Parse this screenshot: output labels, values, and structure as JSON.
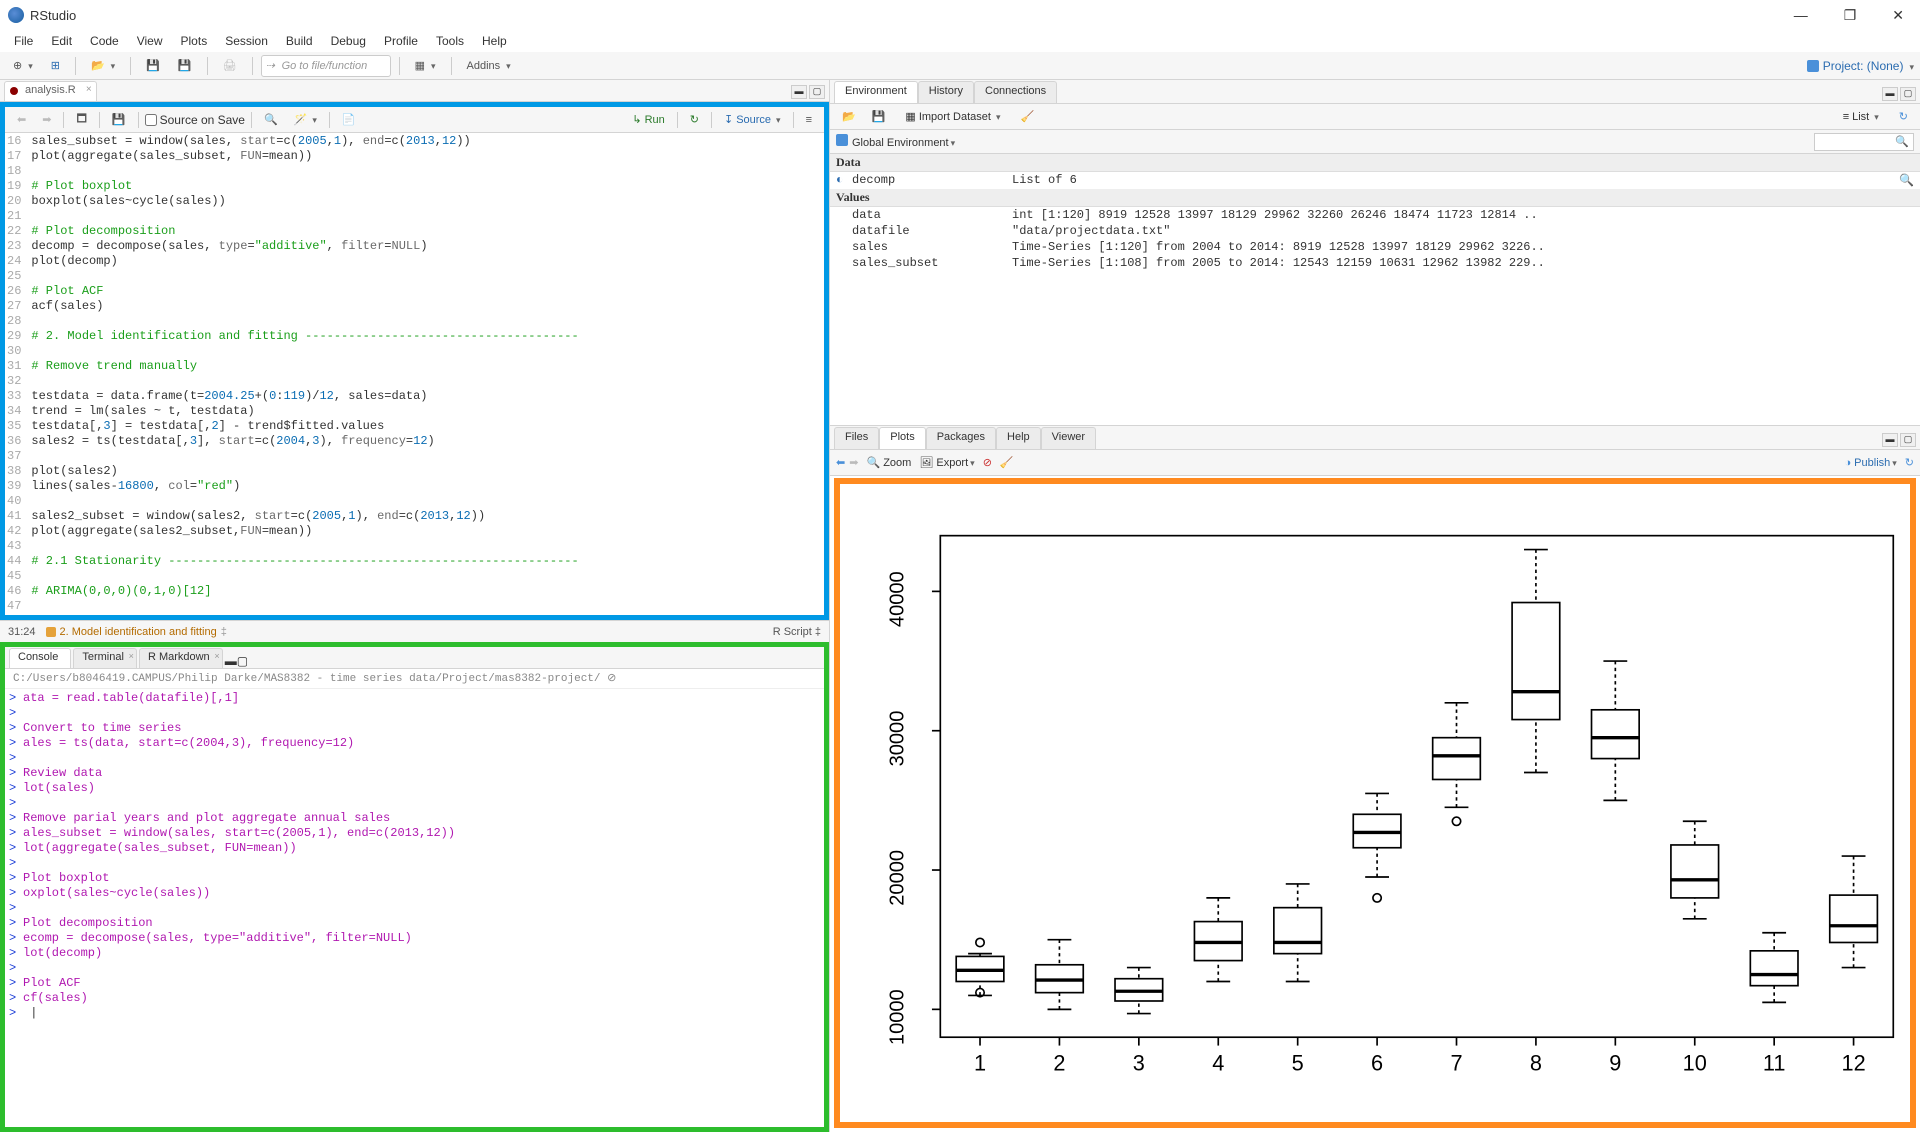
{
  "app": {
    "title": "RStudio"
  },
  "menubar": [
    "File",
    "Edit",
    "Code",
    "View",
    "Plots",
    "Session",
    "Build",
    "Debug",
    "Profile",
    "Tools",
    "Help"
  ],
  "main_toolbar": {
    "gotofile_placeholder": "Go to file/function",
    "addins": "Addins",
    "project": "Project: (None)"
  },
  "editor": {
    "tab": "analysis.R",
    "source_on_save": "Source on Save",
    "run": "Run",
    "source": "Source",
    "status_pos": "31:24",
    "status_crumb": "2. Model identification and fitting",
    "status_right": "R Script",
    "code": [
      {
        "n": 16,
        "t": "sales_subset = window(sales, start=c(2005,1), end=c(2013,12))"
      },
      {
        "n": 17,
        "t": "plot(aggregate(sales_subset, FUN=mean))"
      },
      {
        "n": 18,
        "t": ""
      },
      {
        "n": 19,
        "t": "# Plot boxplot",
        "c": true
      },
      {
        "n": 20,
        "t": "boxplot(sales~cycle(sales))"
      },
      {
        "n": 21,
        "t": ""
      },
      {
        "n": 22,
        "t": "# Plot decomposition",
        "c": true
      },
      {
        "n": 23,
        "t": "decomp = decompose(sales, type=\"additive\", filter=NULL)"
      },
      {
        "n": 24,
        "t": "plot(decomp)"
      },
      {
        "n": 25,
        "t": ""
      },
      {
        "n": 26,
        "t": "# Plot ACF",
        "c": true
      },
      {
        "n": 27,
        "t": "acf(sales)"
      },
      {
        "n": 28,
        "t": ""
      },
      {
        "n": 29,
        "t": "# 2. Model identification and fitting --------------------------------------",
        "c": true
      },
      {
        "n": 30,
        "t": ""
      },
      {
        "n": 31,
        "t": "# Remove trend manually",
        "c": true
      },
      {
        "n": 32,
        "t": ""
      },
      {
        "n": 33,
        "t": "testdata = data.frame(t=2004.25+(0:119)/12, sales=data)"
      },
      {
        "n": 34,
        "t": "trend = lm(sales ~ t, testdata)"
      },
      {
        "n": 35,
        "t": "testdata[,3] = testdata[,2] - trend$fitted.values"
      },
      {
        "n": 36,
        "t": "sales2 = ts(testdata[,3], start=c(2004,3), frequency=12)"
      },
      {
        "n": 37,
        "t": ""
      },
      {
        "n": 38,
        "t": "plot(sales2)"
      },
      {
        "n": 39,
        "t": "lines(sales-16800, col=\"red\")"
      },
      {
        "n": 40,
        "t": ""
      },
      {
        "n": 41,
        "t": "sales2_subset = window(sales2, start=c(2005,1), end=c(2013,12))"
      },
      {
        "n": 42,
        "t": "plot(aggregate(sales2_subset,FUN=mean))"
      },
      {
        "n": 43,
        "t": ""
      },
      {
        "n": 44,
        "t": "# 2.1 Stationarity ---------------------------------------------------------",
        "c": true
      },
      {
        "n": 45,
        "t": ""
      },
      {
        "n": 46,
        "t": "# ARIMA(0,0,0)(0,1,0)[12]",
        "c": true
      },
      {
        "n": 47,
        "t": ""
      }
    ]
  },
  "console": {
    "tabs": [
      "Console",
      "Terminal",
      "R Markdown"
    ],
    "path": "C:/Users/b8046419.CAMPUS/Philip Darke/MAS8382 - time series data/Project/mas8382-project/",
    "lines": [
      "ata = read.table(datafile)[,1]",
      "",
      " Convert to time series",
      "ales = ts(data, start=c(2004,3), frequency=12)",
      "",
      " Review data",
      "lot(sales)",
      "",
      " Remove parial years and plot aggregate annual sales",
      "ales_subset = window(sales, start=c(2005,1), end=c(2013,12))",
      "lot(aggregate(sales_subset, FUN=mean))",
      "",
      " Plot boxplot",
      "oxplot(sales~cycle(sales))",
      "",
      " Plot decomposition",
      "ecomp = decompose(sales, type=\"additive\", filter=NULL)",
      "lot(decomp)",
      "",
      " Plot ACF",
      "cf(sales)"
    ]
  },
  "env": {
    "tabs": [
      "Environment",
      "History",
      "Connections"
    ],
    "import": "Import Dataset",
    "list": "List",
    "scope": "Global Environment",
    "sections": {
      "Data": [
        {
          "name": "decomp",
          "value": "List of 6",
          "exp": true,
          "lens": true
        }
      ],
      "Values": [
        {
          "name": "data",
          "value": "int [1:120] 8919 12528 13997 18129 29962 32260 26246 18474 11723 12814 .."
        },
        {
          "name": "datafile",
          "value": "\"data/projectdata.txt\""
        },
        {
          "name": "sales",
          "value": "Time-Series [1:120] from 2004 to 2014: 8919 12528 13997 18129 29962 3226.."
        },
        {
          "name": "sales_subset",
          "value": "Time-Series [1:108] from 2005 to 2014: 12543 12159 10631 12962 13982 229.."
        }
      ]
    }
  },
  "plots": {
    "tabs": [
      "Files",
      "Plots",
      "Packages",
      "Help",
      "Viewer"
    ],
    "zoom": "Zoom",
    "export": "Export",
    "publish": "Publish"
  },
  "chart_data": {
    "type": "boxplot",
    "xlabel": "",
    "ylabel": "",
    "yticks": [
      10000,
      20000,
      30000,
      40000
    ],
    "xticks": [
      "1",
      "2",
      "3",
      "4",
      "5",
      "6",
      "7",
      "8",
      "9",
      "10",
      "11",
      "12"
    ],
    "ylim": [
      8000,
      44000
    ],
    "series": [
      {
        "x": 1,
        "min": 11000,
        "q1": 12000,
        "med": 12800,
        "q3": 13800,
        "max": 14000,
        "outliers": [
          14800,
          11200
        ]
      },
      {
        "x": 2,
        "min": 10000,
        "q1": 11200,
        "med": 12100,
        "q3": 13200,
        "max": 15000,
        "outliers": []
      },
      {
        "x": 3,
        "min": 9700,
        "q1": 10600,
        "med": 11300,
        "q3": 12200,
        "max": 13000,
        "outliers": []
      },
      {
        "x": 4,
        "min": 12000,
        "q1": 13500,
        "med": 14800,
        "q3": 16300,
        "max": 18000,
        "outliers": []
      },
      {
        "x": 5,
        "min": 12000,
        "q1": 14000,
        "med": 14800,
        "q3": 17300,
        "max": 19000,
        "outliers": []
      },
      {
        "x": 6,
        "min": 19500,
        "q1": 21600,
        "med": 22700,
        "q3": 24000,
        "max": 25500,
        "outliers": [
          18000
        ]
      },
      {
        "x": 7,
        "min": 24500,
        "q1": 26500,
        "med": 28200,
        "q3": 29500,
        "max": 32000,
        "outliers": [
          23500
        ]
      },
      {
        "x": 8,
        "min": 27000,
        "q1": 30800,
        "med": 32800,
        "q3": 39200,
        "max": 43000,
        "outliers": []
      },
      {
        "x": 9,
        "min": 25000,
        "q1": 28000,
        "med": 29500,
        "q3": 31500,
        "max": 35000,
        "outliers": []
      },
      {
        "x": 10,
        "min": 16500,
        "q1": 18000,
        "med": 19300,
        "q3": 21800,
        "max": 23500,
        "outliers": []
      },
      {
        "x": 11,
        "min": 10500,
        "q1": 11700,
        "med": 12500,
        "q3": 14200,
        "max": 15500,
        "outliers": []
      },
      {
        "x": 12,
        "min": 13000,
        "q1": 14800,
        "med": 16000,
        "q3": 18200,
        "max": 21000,
        "outliers": []
      }
    ]
  }
}
